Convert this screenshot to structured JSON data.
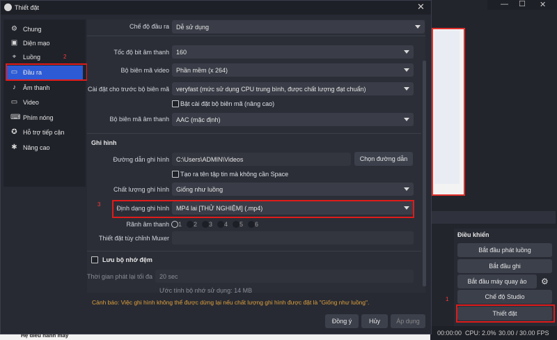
{
  "dialog": {
    "title": "Thiết đặt",
    "close": "✕"
  },
  "sidebar": {
    "items": [
      {
        "label": "Chung",
        "icon": "gear-icon"
      },
      {
        "label": "Diện mạo",
        "icon": "appearance-icon"
      },
      {
        "label": "Luồng",
        "icon": "stream-icon"
      },
      {
        "label": "Đầu ra",
        "icon": "output-icon"
      },
      {
        "label": "Âm thanh",
        "icon": "speaker-icon"
      },
      {
        "label": "Video",
        "icon": "monitor-icon"
      },
      {
        "label": "Phím nóng",
        "icon": "keyboard-icon"
      },
      {
        "label": "Hỗ trợ tiếp cận",
        "icon": "accessibility-icon"
      },
      {
        "label": "Nâng cao",
        "icon": "wrench-icon"
      }
    ]
  },
  "output": {
    "mode_label": "Chế độ đầu ra",
    "mode_value": "Dễ sử dụng",
    "audio_bitrate_label": "Tốc độ bit âm thanh",
    "audio_bitrate_value": "160",
    "video_encoder_label": "Bộ biên mã video",
    "video_encoder_value": "Phần mềm (x 264)",
    "preset_label": "Cài đặt cho trước bộ biên mã",
    "preset_value": "veryfast (mức sử dụng CPU trung bình, được chất lượng đạt chuẩn)",
    "advanced_encoder_label": "Bật cài đặt bộ biên mã (nâng cao)",
    "audio_encoder_label": "Bộ biên mã âm thanh",
    "audio_encoder_value": "AAC (mặc định)"
  },
  "recording": {
    "section_title": "Ghi hình",
    "path_label": "Đường dẫn ghi hình",
    "path_value": "C:\\Users\\ADMIN\\Videos",
    "browse_button": "Chọn đường dẫn",
    "no_space_label": "Tạo ra tên tập tin mà không cần Space",
    "quality_label": "Chất lượng ghi hình",
    "quality_value": "Giống như luồng",
    "format_label": "Định dạng ghi hình",
    "format_value": "MP4 lai [THỬ NGHIỆM] (.mp4)",
    "tracks_label": "Rãnh âm thanh",
    "tracks": [
      "1",
      "2",
      "3",
      "4",
      "5",
      "6"
    ],
    "muxer_label": "Thiết đặt tùy chỉnh Muxer"
  },
  "replay": {
    "enable_label": "Lưu bộ nhớ đệm",
    "max_time_label": "Thời gian phát lại tối đa",
    "max_time_value": "20 sec",
    "estimate": "Ước tính bộ nhớ sử dụng: 14 MB"
  },
  "warning": "Cảnh báo: Việc ghi hình không thể được dừng lại nếu chất lượng ghi hình được đặt là \"Giống như luồng\".",
  "footer": {
    "ok": "Đồng ý",
    "cancel": "Hủy",
    "apply": "Áp dụng"
  },
  "controls": {
    "title": "Điều khiển",
    "start_stream": "Bắt đầu phát luồng",
    "start_record": "Bắt đầu ghi",
    "start_vcam": "Bắt đầu máy quay ảo",
    "studio_mode": "Chế độ Studio",
    "settings": "Thiết đặt"
  },
  "status": {
    "time": "00:00:00",
    "cpu": "CPU: 2.0%",
    "fps": "30.00 / 30.00 FPS"
  },
  "annotations": [
    "1",
    "2",
    "3"
  ],
  "bottom_caption": "Hệ điều hành máy",
  "colors": {
    "accent": "#2d5bd6",
    "highlight": "#e01b1b",
    "warning": "#e0a13c"
  }
}
